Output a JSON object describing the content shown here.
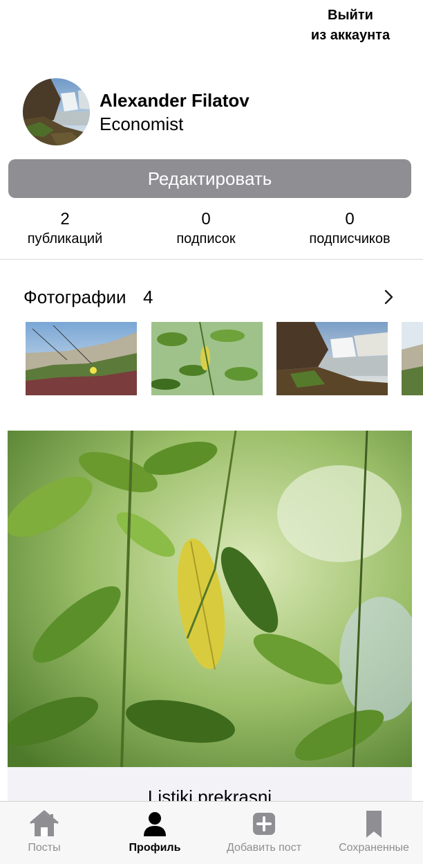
{
  "header": {
    "logout_line1": "Выйти",
    "logout_line2": "из аккаунта"
  },
  "profile": {
    "name": "Alexander Filatov",
    "role": "Economist",
    "edit_label": "Редактировать"
  },
  "stats": [
    {
      "value": "2",
      "label": "публикаций"
    },
    {
      "value": "0",
      "label": "подписок"
    },
    {
      "value": "0",
      "label": "подписчиков"
    }
  ],
  "photos": {
    "title": "Фотографии",
    "count": "4",
    "chevron_icon": "chevron-right-icon"
  },
  "post": {
    "caption": "Listiki prekrasni"
  },
  "tabbar": {
    "items": [
      {
        "label": "Посты",
        "icon": "house-icon",
        "active": false
      },
      {
        "label": "Профиль",
        "icon": "person-icon",
        "active": true
      },
      {
        "label": "Добавить пост",
        "icon": "plus-square-icon",
        "active": false
      },
      {
        "label": "Сохраненные",
        "icon": "bookmark-icon",
        "active": false
      }
    ]
  },
  "colors": {
    "edit_button": "#8e8e93",
    "inactive_tab": "#8e8e93",
    "active_tab": "#000000",
    "tabbar_bg": "#f7f7f7",
    "caption_bg": "#f2f2f7"
  }
}
